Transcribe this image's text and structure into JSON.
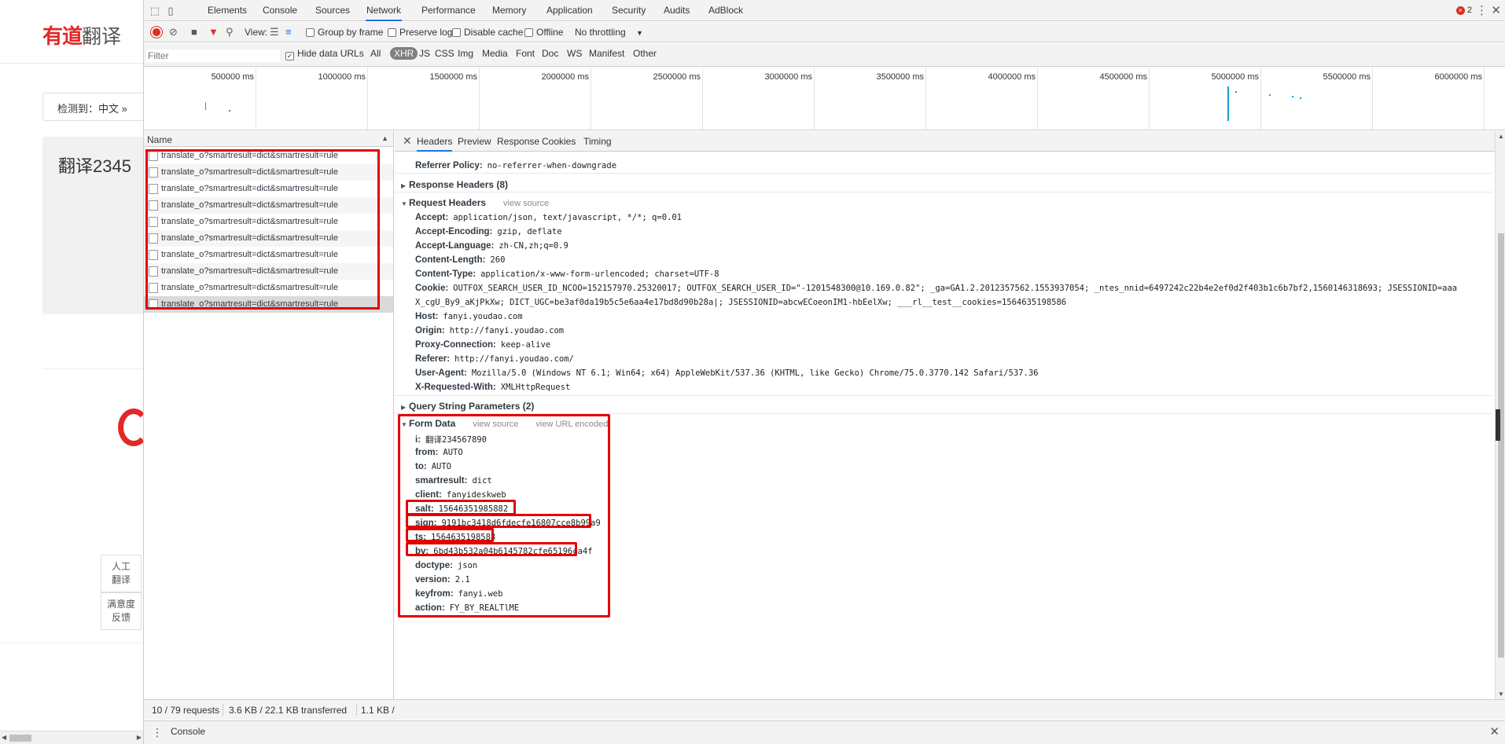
{
  "page": {
    "logo_red": "有道",
    "logo_gray": "翻译",
    "detect_text": "检测到：中文  »",
    "source_text": "翻译2345",
    "side_buttons": [
      {
        "line1": "人工",
        "line2": "翻译"
      },
      {
        "line1": "满意度",
        "line2": "反馈"
      }
    ]
  },
  "devtools": {
    "tabs": [
      "Elements",
      "Console",
      "Sources",
      "Network",
      "Performance",
      "Memory",
      "Application",
      "Security",
      "Audits",
      "AdBlock"
    ],
    "active_tab": "Network",
    "error_count": "2",
    "toolbar": {
      "view_label": "View:",
      "group_by_frame": "Group by frame",
      "preserve_log": "Preserve log",
      "disable_cache": "Disable cache",
      "offline": "Offline",
      "throttling": "No throttling"
    },
    "filter": {
      "placeholder": "Filter",
      "hide_data_urls": "Hide data URLs",
      "types": [
        "All",
        "XHR",
        "JS",
        "CSS",
        "Img",
        "Media",
        "Font",
        "Doc",
        "WS",
        "Manifest",
        "Other"
      ],
      "selected_type": "XHR"
    },
    "timeline_labels": [
      "500000 ms",
      "1000000 ms",
      "1500000 ms",
      "2000000 ms",
      "2500000 ms",
      "3000000 ms",
      "3500000 ms",
      "4000000 ms",
      "4500000 ms",
      "5000000 ms",
      "5500000 ms",
      "6000000 ms"
    ],
    "list": {
      "header": "Name",
      "rows": [
        "translate_o?smartresult=dict&smartresult=rule",
        "translate_o?smartresult=dict&smartresult=rule",
        "translate_o?smartresult=dict&smartresult=rule",
        "translate_o?smartresult=dict&smartresult=rule",
        "translate_o?smartresult=dict&smartresult=rule",
        "translate_o?smartresult=dict&smartresult=rule",
        "translate_o?smartresult=dict&smartresult=rule",
        "translate_o?smartresult=dict&smartresult=rule",
        "translate_o?smartresult=dict&smartresult=rule",
        "translate_o?smartresult=dict&smartresult=rule"
      ]
    },
    "detail_tabs": [
      "Headers",
      "Preview",
      "Response",
      "Cookies",
      "Timing"
    ],
    "active_detail_tab": "Headers",
    "referrer_policy": {
      "key": "Referrer Policy:",
      "value": "no-referrer-when-downgrade"
    },
    "response_headers_title": "Response Headers (8)",
    "request_headers_title": "Request Headers",
    "view_source": "view source",
    "request_headers": [
      {
        "key": "Accept:",
        "value": "application/json, text/javascript, */*; q=0.01"
      },
      {
        "key": "Accept-Encoding:",
        "value": "gzip, deflate"
      },
      {
        "key": "Accept-Language:",
        "value": "zh-CN,zh;q=0.9"
      },
      {
        "key": "Content-Length:",
        "value": "260"
      },
      {
        "key": "Content-Type:",
        "value": "application/x-www-form-urlencoded; charset=UTF-8"
      },
      {
        "key": "Cookie:",
        "value": "OUTFOX_SEARCH_USER_ID_NCOO=152157970.25320017; OUTFOX_SEARCH_USER_ID=\"-1201548300@10.169.0.82\"; _ga=GA1.2.2012357562.1553937054; _ntes_nnid=6497242c22b4e2ef0d2f403b1c6b7bf2,1560146318693; JSESSIONID=aaa"
      },
      {
        "key": "",
        "value": "X_cgU_By9_aKjPkXw; DICT_UGC=be3af0da19b5c5e6aa4e17bd8d90b28a|; JSESSIONID=abcwECoeonIM1-hbEelXw; ___rl__test__cookies=1564635198586"
      },
      {
        "key": "Host:",
        "value": "fanyi.youdao.com"
      },
      {
        "key": "Origin:",
        "value": "http://fanyi.youdao.com"
      },
      {
        "key": "Proxy-Connection:",
        "value": "keep-alive"
      },
      {
        "key": "Referer:",
        "value": "http://fanyi.youdao.com/"
      },
      {
        "key": "User-Agent:",
        "value": "Mozilla/5.0 (Windows NT 6.1; Win64; x64) AppleWebKit/537.36 (KHTML, like Gecko) Chrome/75.0.3770.142 Safari/537.36"
      },
      {
        "key": "X-Requested-With:",
        "value": "XMLHttpRequest"
      }
    ],
    "query_string_title": "Query String Parameters (2)",
    "form_data_title": "Form Data",
    "view_url_encoded": "view URL encoded",
    "form_data": [
      {
        "key": "i:",
        "value": "翻译234567890"
      },
      {
        "key": "from:",
        "value": "AUTO"
      },
      {
        "key": "to:",
        "value": "AUTO"
      },
      {
        "key": "smartresult:",
        "value": "dict"
      },
      {
        "key": "client:",
        "value": "fanyideskweb"
      },
      {
        "key": "salt:",
        "value": "15646351985882"
      },
      {
        "key": "sign:",
        "value": "9191bc3418d6fdecfe16807cce8b99a9"
      },
      {
        "key": "ts:",
        "value": "1564635198588"
      },
      {
        "key": "bv:",
        "value": "6bd43b532a04b6145782cfe65196ca4f"
      },
      {
        "key": "doctype:",
        "value": "json"
      },
      {
        "key": "version:",
        "value": "2.1"
      },
      {
        "key": "keyfrom:",
        "value": "fanyi.web"
      },
      {
        "key": "action:",
        "value": "FY_BY_REALTlME"
      }
    ],
    "summary": {
      "requests": "10 / 79 requests",
      "transferred": "3.6 KB / 22.1 KB transferred",
      "resources": "1.1 KB /"
    },
    "drawer_tab": "Console",
    "accent_color": "#1a73e8",
    "highlight_color": "#e30000"
  }
}
